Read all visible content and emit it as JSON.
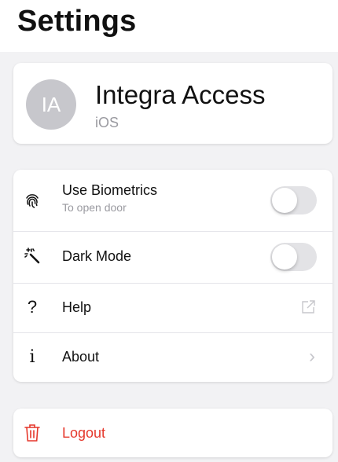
{
  "page": {
    "title": "Settings"
  },
  "profile": {
    "initials": "IA",
    "name": "Integra Access",
    "platform": "iOS"
  },
  "settings": {
    "items": [
      {
        "label": "Use Biometrics",
        "sublabel": "To open door",
        "icon": "fingerprint-icon",
        "control": "toggle",
        "enabled": false
      },
      {
        "label": "Dark Mode",
        "icon": "magic-wand-icon",
        "control": "toggle",
        "enabled": false
      },
      {
        "label": "Help",
        "icon": "question-mark-icon",
        "glyph": "?",
        "control": "external-link"
      },
      {
        "label": "About",
        "icon": "info-icon",
        "glyph": "i",
        "control": "chevron",
        "chevron": "›"
      }
    ]
  },
  "logout": {
    "label": "Logout",
    "icon": "trash-icon",
    "color": "#e5372b"
  },
  "colors": {
    "background": "#f2f2f4",
    "card": "#ffffff",
    "destructive": "#e5372b",
    "toggle_off": "#e3e3e6"
  }
}
